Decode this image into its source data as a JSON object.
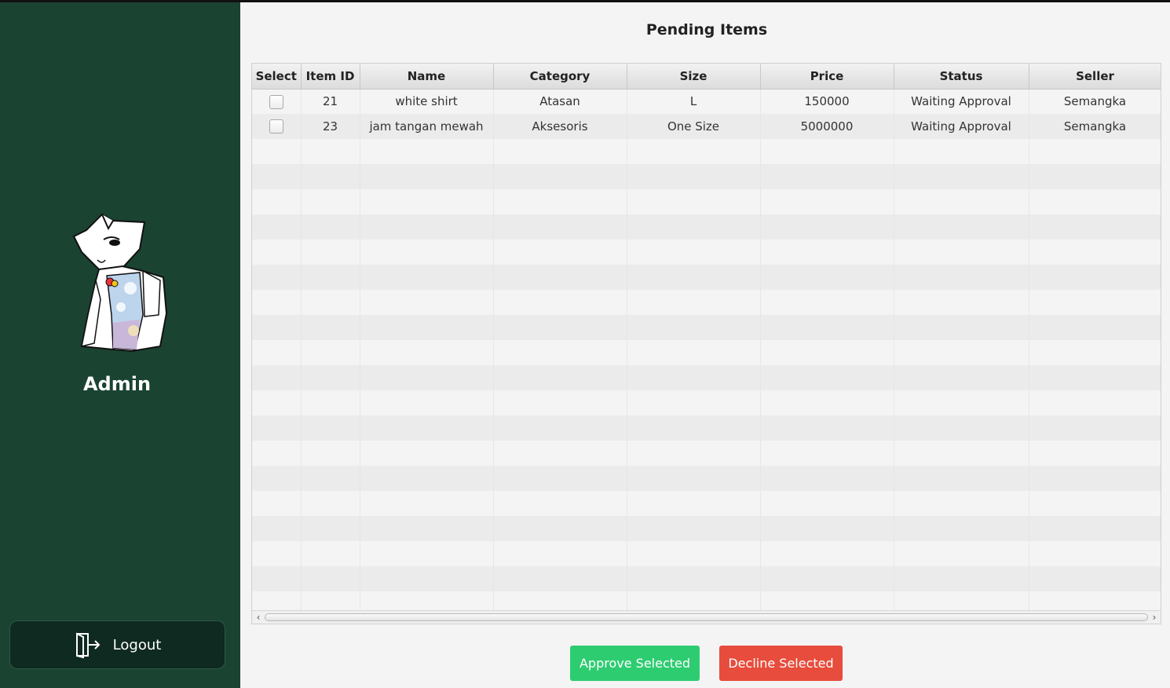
{
  "sidebar": {
    "username": "Admin",
    "logout_label": "Logout",
    "logout_icon": "logout-door-icon",
    "background": "#1b4332"
  },
  "main": {
    "title": "Pending Items",
    "table": {
      "columns": [
        "Select",
        "Item ID",
        "Name",
        "Category",
        "Size",
        "Price",
        "Status",
        "Seller"
      ],
      "rows": [
        {
          "selected": false,
          "item_id": "21",
          "name": "white shirt",
          "category": "Atasan",
          "size": "L",
          "price": "150000",
          "status": "Waiting Approval",
          "seller": "Semangka"
        },
        {
          "selected": false,
          "item_id": "23",
          "name": "jam tangan mewah",
          "category": "Aksesoris",
          "size": "One Size",
          "price": "5000000",
          "status": "Waiting Approval",
          "seller": "Semangka"
        }
      ]
    },
    "approve_label": "Approve Selected",
    "decline_label": "Decline Selected",
    "approve_color": "#2ecc71",
    "decline_color": "#e74c3c"
  }
}
